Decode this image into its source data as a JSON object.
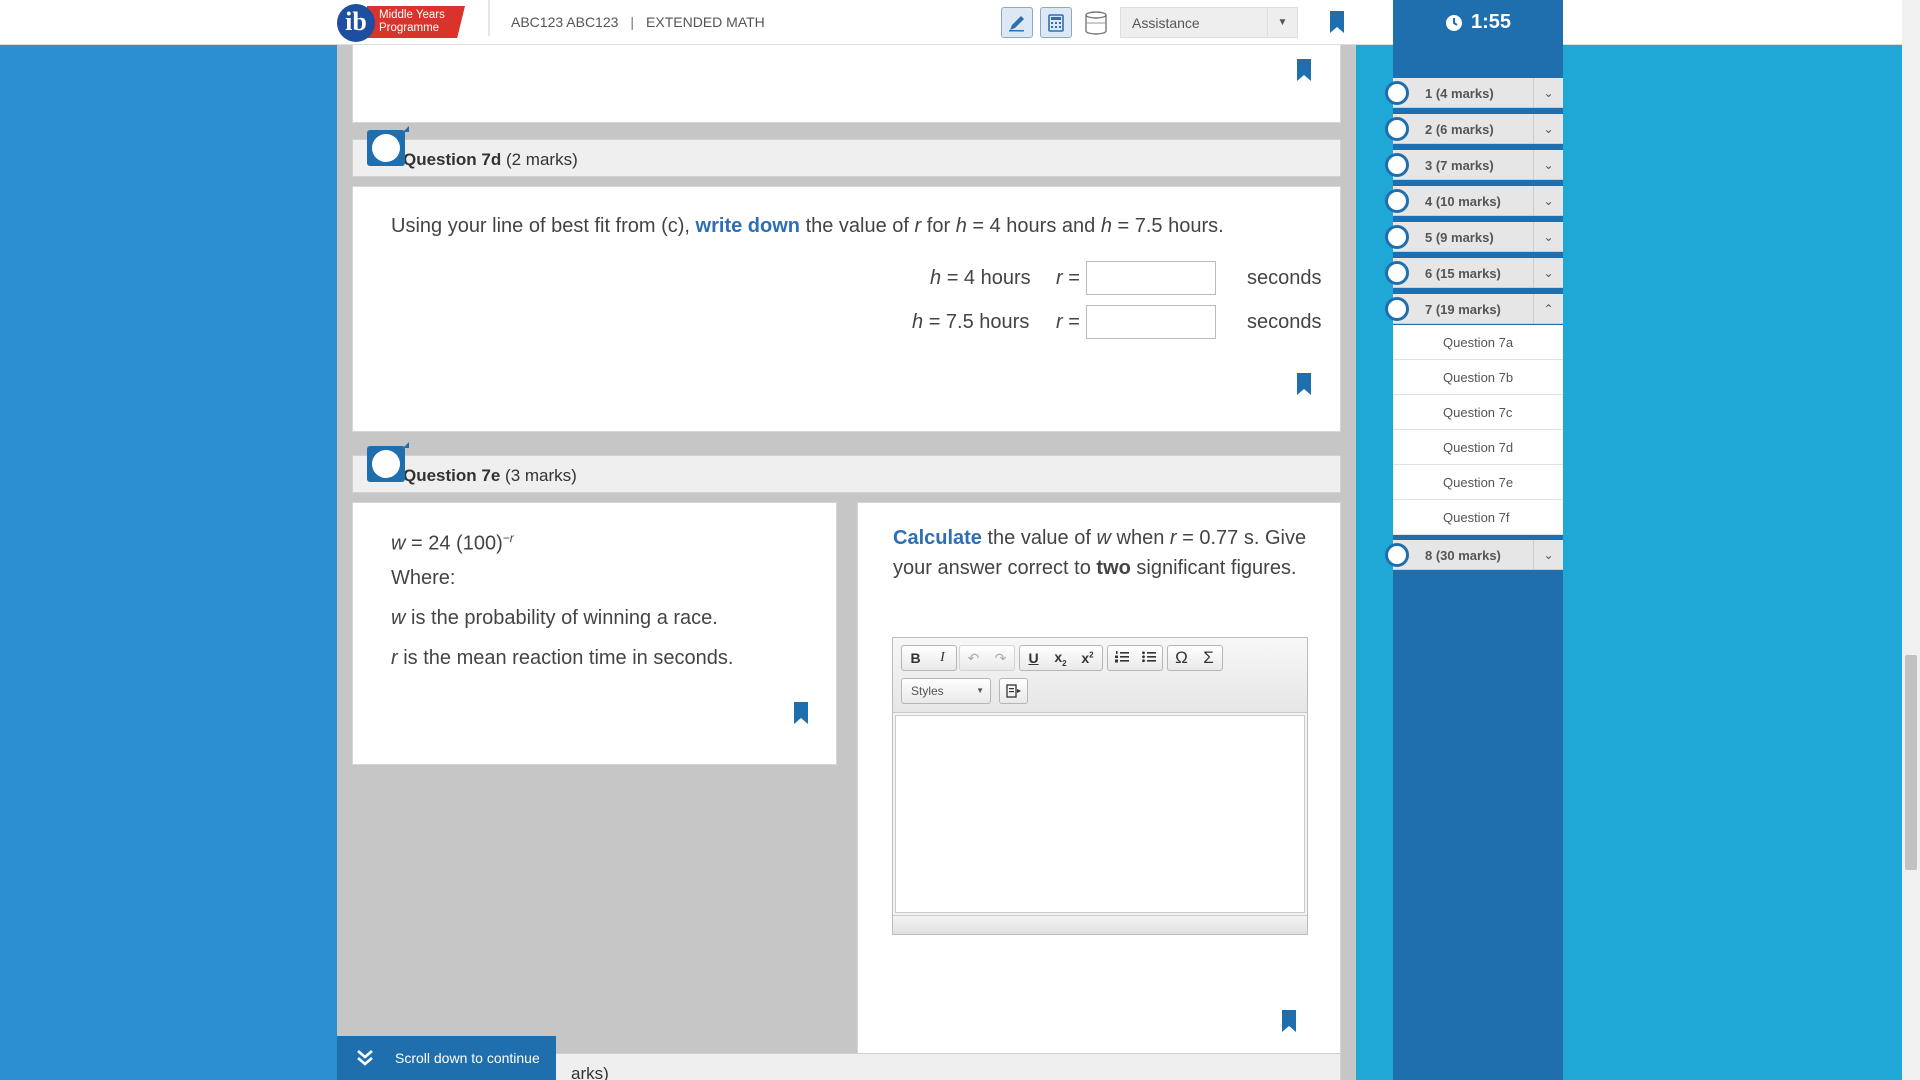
{
  "header": {
    "logo_line1": "Middle Years",
    "logo_line2": "Programme",
    "candidate": "ABC123 ABC123",
    "separator": "|",
    "subject": "EXTENDED MATH",
    "assistance": "Assistance",
    "timer": "1:55"
  },
  "q7d": {
    "title_num": "Question 7d",
    "title_marks": "(2 marks)",
    "text_pre": "Using your line of best fit from (c),",
    "text_cmd": "write down",
    "text_post": "the value of",
    "text_r": "r",
    "text_for": "for",
    "text_h1": "h",
    "text_eq1": "= 4 hours and",
    "text_h2": "h",
    "text_eq2": "= 7.5 hours.",
    "row1_h": "h",
    "row1_val": "= 4 hours",
    "row2_h": "h",
    "row2_val": "= 7.5 hours",
    "r_label": "r",
    "eq": "=",
    "unit": "seconds"
  },
  "q7e": {
    "title_num": "Question 7e",
    "title_marks": "(3 marks)",
    "formula_w": "w",
    "formula_mid": "= 24 (100)",
    "formula_exp": "−r",
    "where": "Where:",
    "def1_var": "w",
    "def1_text": "is the probability of winning a race.",
    "def2_var": "r",
    "def2_text": "is the mean reaction time in seconds.",
    "cmd": "Calculate",
    "task1": "the value of",
    "task_w": "w",
    "task2": "when",
    "task_r": "r",
    "task3": "= 0.77 s.",
    "task4": "Give your answer correct to",
    "task_bold": "two",
    "task5": "significant figures.",
    "editor_styles": "Styles"
  },
  "next_partial": "arks)",
  "scroll_cta": "Scroll down to continue",
  "nav": {
    "items": [
      {
        "label": "1 (4 marks)",
        "chev": "⌄"
      },
      {
        "label": "2 (6 marks)",
        "chev": "⌄"
      },
      {
        "label": "3 (7 marks)",
        "chev": "⌄"
      },
      {
        "label": "4 (10 marks)",
        "chev": "⌄"
      },
      {
        "label": "5 (9 marks)",
        "chev": "⌄"
      },
      {
        "label": "6 (15 marks)",
        "chev": "⌄"
      },
      {
        "label": "7 (19 marks)",
        "chev": "⌃"
      }
    ],
    "subitems": [
      "Question 7a",
      "Question 7b",
      "Question 7c",
      "Question 7d",
      "Question 7e",
      "Question 7f"
    ],
    "last": {
      "label": "8 (30 marks)",
      "chev": "⌄"
    }
  }
}
